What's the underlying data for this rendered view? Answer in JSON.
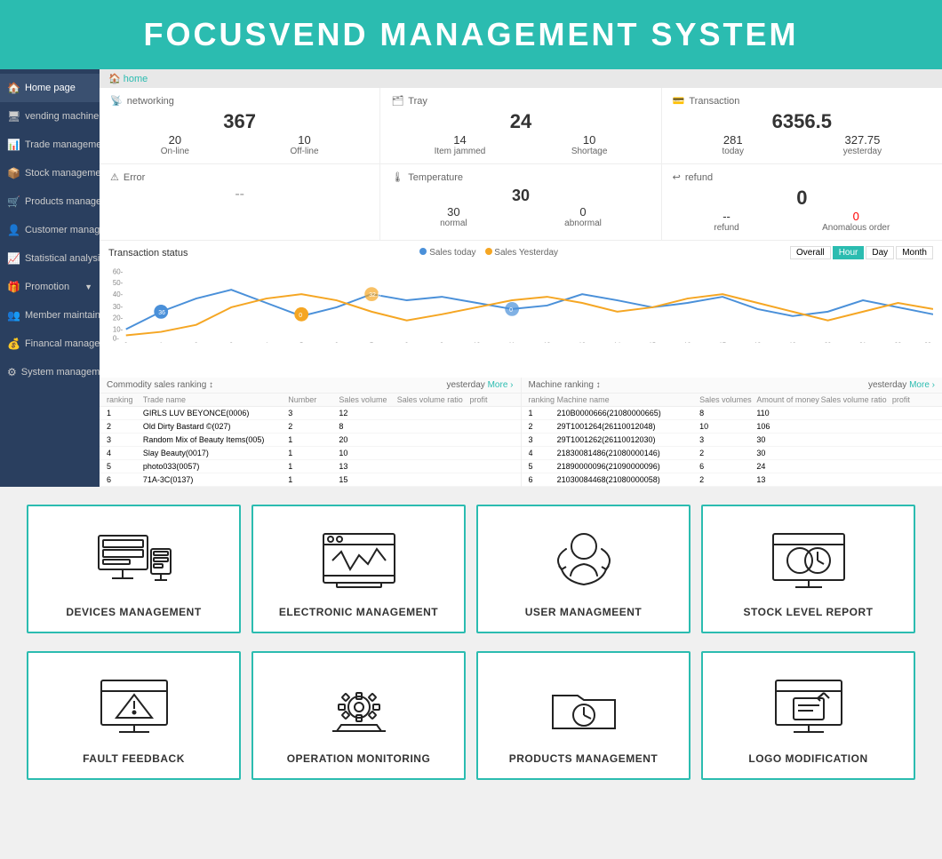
{
  "header": {
    "title": "FOCUSVEND MANAGEMENT SYSTEM"
  },
  "sidebar": {
    "items": [
      {
        "label": "Home page",
        "icon": "🏠",
        "active": true,
        "hasArrow": false
      },
      {
        "label": "vending machine",
        "icon": "🖥",
        "active": false,
        "hasArrow": true
      },
      {
        "label": "Trade management",
        "icon": "📊",
        "active": false,
        "hasArrow": true
      },
      {
        "label": "Stock management",
        "icon": "📦",
        "active": false,
        "hasArrow": true
      },
      {
        "label": "Products management",
        "icon": "🛒",
        "active": false,
        "hasArrow": false
      },
      {
        "label": "Customer management",
        "icon": "👤",
        "active": false,
        "hasArrow": false
      },
      {
        "label": "Statistical analysis",
        "icon": "📈",
        "active": false,
        "hasArrow": true
      },
      {
        "label": "Promotion",
        "icon": "🎁",
        "active": false,
        "hasArrow": true
      },
      {
        "label": "Member maintain",
        "icon": "👥",
        "active": false,
        "hasArrow": true
      },
      {
        "label": "Financal management",
        "icon": "💰",
        "active": false,
        "hasArrow": false
      },
      {
        "label": "System management",
        "icon": "⚙",
        "active": false,
        "hasArrow": false
      }
    ]
  },
  "breadcrumb": "home",
  "stats": {
    "networking": {
      "title": "networking",
      "main": "367",
      "sub": [
        {
          "num": "20",
          "label": "On-line"
        },
        {
          "num": "10",
          "label": "Off-line"
        }
      ]
    },
    "tray": {
      "title": "Tray",
      "main": "24",
      "sub": [
        {
          "num": "14",
          "label": "Item jammed"
        },
        {
          "num": "10",
          "label": "Shortage"
        }
      ]
    },
    "transaction": {
      "title": "Transaction",
      "main": "6356.5",
      "sub": [
        {
          "num": "281",
          "label": "today"
        },
        {
          "num": "327.75",
          "label": "yesterday"
        }
      ]
    },
    "error": {
      "title": "Error",
      "main": "--"
    },
    "temperature": {
      "title": "Temperature",
      "main": "30",
      "sub": [
        {
          "num": "30",
          "label": "normal"
        },
        {
          "num": "0",
          "label": "abnormal"
        }
      ]
    },
    "refund": {
      "title": "refund",
      "main": "0",
      "sub": [
        {
          "num": "--",
          "label": "refund"
        },
        {
          "num": "0",
          "label": "Anomalous order"
        }
      ]
    }
  },
  "chart": {
    "title": "Transaction status",
    "legend": [
      {
        "label": "Sales today",
        "color": "#4a90d9"
      },
      {
        "label": "Sales Yesterday",
        "color": "#f5a623"
      }
    ],
    "controls": [
      "Overall",
      "Hour",
      "Day",
      "Month"
    ],
    "activeControl": "Hour"
  },
  "commodityTable": {
    "title": "Commodity sales ranking",
    "link": "More",
    "columns": [
      "ranking",
      "Trade name",
      "Number",
      "Sales volume",
      "Sales volume ratio",
      "profit"
    ],
    "rows": [
      [
        "1",
        "GIRLS LUV BEYONCE(0006)",
        "3",
        "12",
        "",
        ""
      ],
      [
        "2",
        "Old Dirty Bastard ©(027)",
        "2",
        "8",
        "",
        ""
      ],
      [
        "3",
        "Random Mix of Beauty Items(005)",
        "1",
        "20",
        "",
        ""
      ],
      [
        "4",
        "Slay Beauty(0017)",
        "1",
        "10",
        "",
        ""
      ],
      [
        "5",
        "photo033(0057)",
        "1",
        "13",
        "",
        ""
      ],
      [
        "6",
        "71A-3C(0137)",
        "1",
        "15",
        "",
        ""
      ]
    ]
  },
  "machineTable": {
    "title": "Machine ranking",
    "link": "More",
    "columns": [
      "ranking",
      "Machine name",
      "Sales volumes",
      "Amount of money",
      "Sales volume ratio",
      "profit"
    ],
    "rows": [
      [
        "1",
        "210B0000666(21080000665)",
        "8",
        "110",
        "",
        ""
      ],
      [
        "2",
        "29T1001264(26110012048)",
        "10",
        "106",
        "",
        ""
      ],
      [
        "3",
        "29T1001262(26110012030)",
        "3",
        "30",
        "",
        ""
      ],
      [
        "4",
        "21830081486(21080000146)",
        "2",
        "30",
        "",
        ""
      ],
      [
        "5",
        "21890000096(21090000096)",
        "6",
        "24",
        "",
        ""
      ],
      [
        "6",
        "21030084468(21080000058)",
        "2",
        "13",
        "",
        ""
      ]
    ]
  },
  "cards_row1": [
    {
      "label": "DEVICES MANAGEMENT",
      "icon": "devices"
    },
    {
      "label": "ELECTRONIC MANAGEMENT",
      "icon": "electronic"
    },
    {
      "label": "USER MANAGMEENT",
      "icon": "user"
    },
    {
      "label": "STOCK LEVEL REPORT",
      "icon": "stock"
    }
  ],
  "cards_row2": [
    {
      "label": "FAULT FEEDBACK",
      "icon": "fault"
    },
    {
      "label": "OPERATION MONITORING",
      "icon": "operation"
    },
    {
      "label": "PRODUCTS MANAGEMENT",
      "icon": "products"
    },
    {
      "label": "LOGO MODIFICATION",
      "icon": "logo"
    }
  ]
}
